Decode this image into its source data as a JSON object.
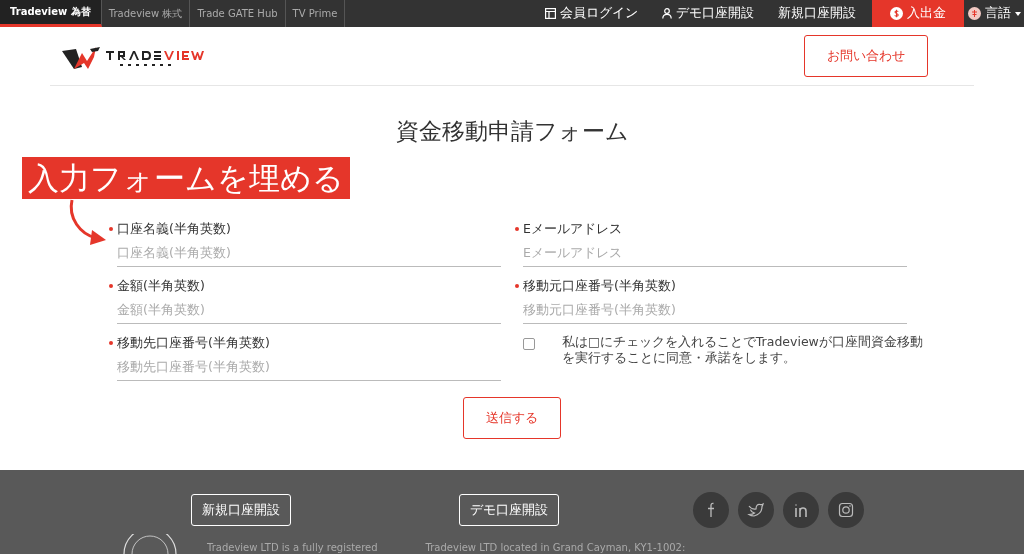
{
  "top_nav": {
    "tabs": [
      {
        "label": "Tradeview 為替",
        "selected": true
      },
      {
        "label": "Tradeview 株式",
        "selected": false
      },
      {
        "label": "Trade GATE Hub",
        "selected": false
      },
      {
        "label": "TV Prime",
        "selected": false
      }
    ],
    "links": [
      {
        "label": "会員ログイン",
        "kind": "login"
      },
      {
        "label": "デモ口座開設",
        "kind": "demo"
      },
      {
        "label": "新規口座開設",
        "kind": "plain"
      },
      {
        "label": "入出金",
        "kind": "deposit"
      },
      {
        "label": "言語",
        "kind": "language"
      }
    ]
  },
  "header": {
    "contact_button": "お問い合わせ"
  },
  "form": {
    "title": "資金移動申請フォーム",
    "annotation": "入力フォームを埋める",
    "fields": [
      {
        "label": "口座名義(半角英数)",
        "placeholder": "口座名義(半角英数)",
        "required": true
      },
      {
        "label": "Eメールアドレス",
        "placeholder": "Eメールアドレス",
        "required": true
      },
      {
        "label": "金額(半角英数)",
        "placeholder": "金額(半角英数)",
        "required": true
      },
      {
        "label": "移動元口座番号(半角英数)",
        "placeholder": "移動元口座番号(半角英数)",
        "required": true
      },
      {
        "label": "移動先口座番号(半角英数)",
        "placeholder": "移動先口座番号(半角英数)",
        "required": true
      }
    ],
    "consent": {
      "checked": false,
      "text": "私は□にチェックを入れることでTradeviewが口座間資金移動を実行することに同意・承諾をします。"
    },
    "submit": "送信する"
  },
  "footer": {
    "buttons": [
      "新規口座開設",
      "デモ口座開設"
    ],
    "texts": [
      "Tradeview LTD is a fully registered",
      "Tradeview LTD located in Grand Cayman, KY1-1002:"
    ]
  }
}
